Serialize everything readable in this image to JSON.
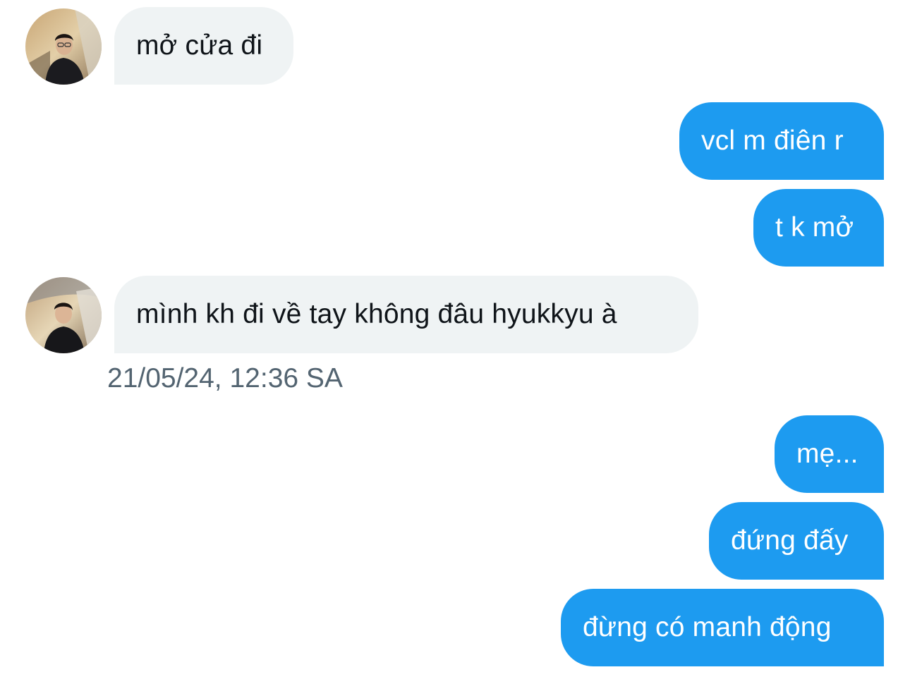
{
  "conversation": {
    "messages": [
      {
        "direction": "in",
        "text": "mở cửa đi"
      },
      {
        "direction": "out",
        "text": "vcl m điên r"
      },
      {
        "direction": "out",
        "text": "t k mở"
      },
      {
        "direction": "in",
        "text": "mình kh đi về tay không đâu hyukkyu à"
      },
      {
        "direction": "out",
        "text": "mẹ..."
      },
      {
        "direction": "out",
        "text": "đứng đấy"
      },
      {
        "direction": "out",
        "text": "đừng có manh động"
      }
    ],
    "timestamp": "21/05/24, 12:36 SA"
  },
  "colors": {
    "incoming_bubble": "#eff3f4",
    "outgoing_bubble": "#1d9bf0",
    "incoming_text": "#0f1419",
    "outgoing_text": "#ffffff",
    "timestamp_text": "#536471"
  },
  "icons": {
    "contact_avatar": "avatar-photo"
  }
}
